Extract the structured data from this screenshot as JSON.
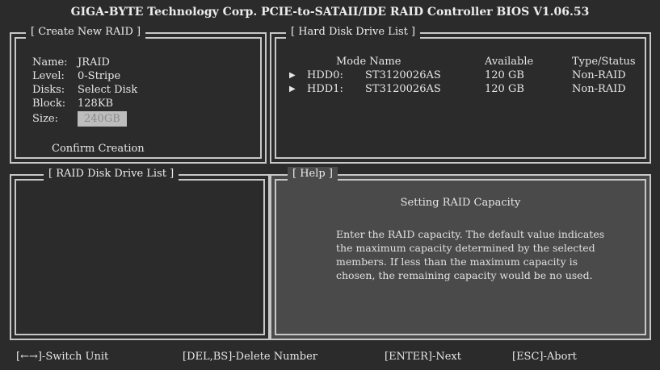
{
  "title": "GIGA-BYTE Technology Corp. PCIE-to-SATAII/IDE RAID Controller BIOS V1.06.53",
  "create_raid": {
    "heading": "[ Create New RAID ]",
    "name_label": "Name:",
    "name_value": "JRAID",
    "level_label": "Level:",
    "level_value": "0-Stripe",
    "disks_label": "Disks:",
    "disks_value": "Select Disk",
    "block_label": "Block:",
    "block_value": "128KB",
    "size_label": "Size:",
    "size_value": "240GB",
    "confirm_label": "Confirm Creation"
  },
  "hdd_list": {
    "heading": "[ Hard Disk Drive List ]",
    "col_mode_name": "Mode Name",
    "col_available": "Available",
    "col_type_status": "Type/Status",
    "rows": [
      {
        "arrow": "▶",
        "id": "HDD0:",
        "model": "ST3120026AS",
        "available": "120 GB",
        "status": "Non-RAID"
      },
      {
        "arrow": "▶",
        "id": "HDD1:",
        "model": "ST3120026AS",
        "available": "120 GB",
        "status": "Non-RAID"
      }
    ]
  },
  "raid_list": {
    "heading": "[ RAID Disk Drive List ]"
  },
  "help": {
    "heading": "[ Help ]",
    "subtitle": "Setting RAID Capacity",
    "body": "Enter the RAID capacity. The default value indicates the maximum capacity determined by the selected members. If less than the maximum capacity is chosen, the remaining capacity would be no used."
  },
  "footer": {
    "switch": "[←→]-Switch Unit",
    "delete": "[DEL,BS]-Delete Number",
    "next": "[ENTER]-Next",
    "abort": "[ESC]-Abort"
  }
}
